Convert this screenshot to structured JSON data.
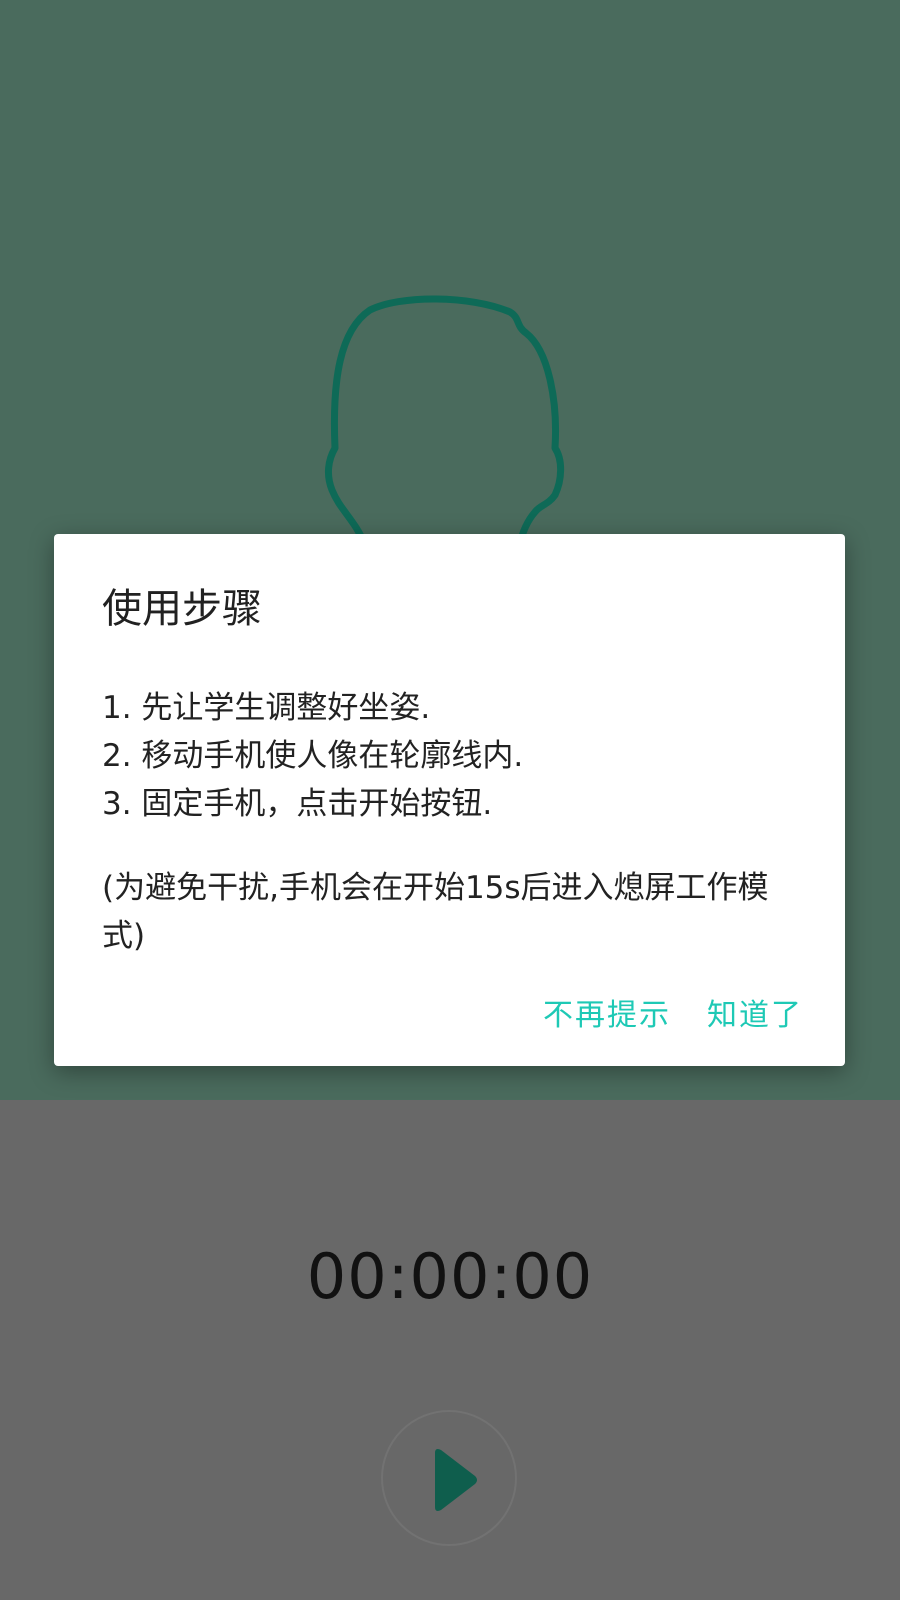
{
  "colors": {
    "camera_bg": "#4a6b5d",
    "outline_stroke": "#0e6a57",
    "bottom_bg": "#686868",
    "accent": "#1ec9b5",
    "play_icon": "#0f5e4d"
  },
  "dialog": {
    "title": "使用步骤",
    "steps": [
      "1. 先让学生调整好坐姿.",
      "2. 移动手机使人像在轮廓线内.",
      "3. 固定手机，点击开始按钮."
    ],
    "note_line1": "(为避免干扰,手机会在开始15s后进入熄屏工作模",
    "note_line2": "式)",
    "dismiss_forever_label": "不再提示",
    "ok_label": "知道了"
  },
  "recorder": {
    "timer": "00:00:00",
    "play_icon": "play-icon"
  }
}
